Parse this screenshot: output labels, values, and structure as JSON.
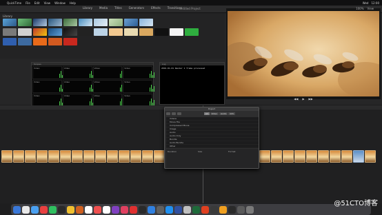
{
  "menubar": {
    "app_name": "QuickTime",
    "items": [
      "File",
      "Edit",
      "View",
      "Window",
      "Help"
    ],
    "right": [
      "Wed",
      "12:00"
    ]
  },
  "toolbar": {
    "title": "Untitled Project",
    "tabs": [
      "Library",
      "Media",
      "Titles",
      "Generators",
      "Effects",
      "Transitions"
    ]
  },
  "browser": {
    "label": "Library"
  },
  "scopes": {
    "header": "Scopes",
    "cells": [
      "Video",
      "Video",
      "Video",
      "Video",
      "Video",
      "Video",
      "Video",
      "Video",
      "Video",
      "Video",
      "Video",
      "Video",
      "Video",
      "Video",
      "Video",
      "Video",
      "Video",
      "Video",
      "Video",
      "Video"
    ]
  },
  "console": {
    "header": "Log",
    "text": "2019-01-01 Render 1 frame processed"
  },
  "preview": {
    "controls": [
      "◀◀",
      "▶",
      "▶▶"
    ],
    "top": [
      "100%",
      "View"
    ]
  },
  "dialog": {
    "title": "Export",
    "segments": [
      "All",
      "Video",
      "Audio",
      "Info"
    ],
    "rows": [
      "Videos",
      "Movie File",
      "Compressed Movie",
      "Image",
      "Audio",
      "Audio Only",
      "Bundle",
      "Audio Bundle",
      "Other"
    ],
    "footer": [
      "Duration",
      "Size",
      "Format"
    ]
  },
  "watermark": "@51CTO博客",
  "colors": {
    "accent": "#4bd04b",
    "bg": "#1e1e1f"
  }
}
